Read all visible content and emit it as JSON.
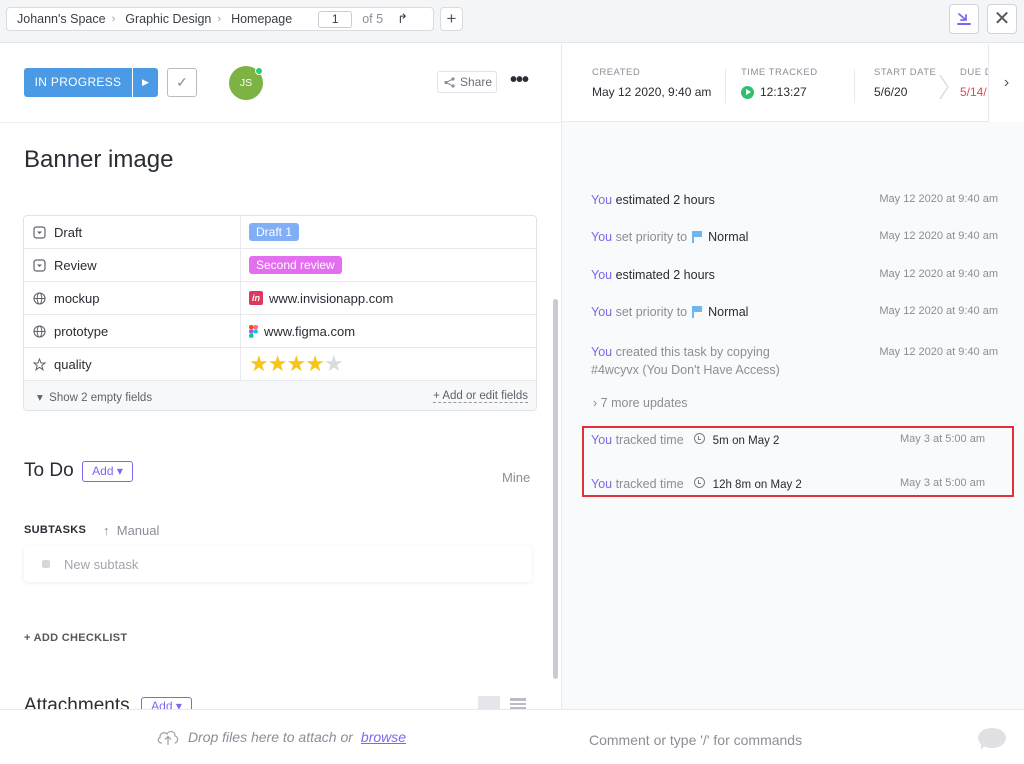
{
  "topbar": {
    "breadcrumbs": [
      "Johann's Space",
      "Graphic Design",
      "Homepage"
    ],
    "page_current": "1",
    "page_total": "of 5"
  },
  "task": {
    "status": "IN PROGRESS",
    "assignee_initials": "JS",
    "share_label": "Share",
    "title": "Banner image"
  },
  "fields": [
    {
      "name": "Draft",
      "icon": "dropdown-icon",
      "value": "Draft 1",
      "tag_color": "#80aef7"
    },
    {
      "name": "Review",
      "icon": "dropdown-icon",
      "value": "Second review",
      "tag_color": "#e36ff0"
    },
    {
      "name": "mockup",
      "icon": "globe-icon",
      "value": "www.invisionapp.com",
      "site_icon": "invision-icon"
    },
    {
      "name": "prototype",
      "icon": "globe-icon",
      "value": "www.figma.com",
      "site_icon": "figma-icon"
    },
    {
      "name": "quality",
      "icon": "star-outline-icon",
      "rating": 4,
      "rating_max": 5
    }
  ],
  "fields_footer": {
    "show_empty": "Show 2 empty fields",
    "add_edit": "+ Add or edit fields"
  },
  "todo": {
    "title": "To Do",
    "add_label": "Add",
    "mine_label": "Mine",
    "subtasks_label": "SUBTASKS",
    "sort_label": "Manual",
    "new_subtask_placeholder": "New subtask",
    "add_checklist": "+ ADD CHECKLIST"
  },
  "attachments": {
    "title": "Attachments",
    "add_label": "Add",
    "drop_text": "Drop files here to attach or",
    "browse_label": "browse"
  },
  "meta": {
    "created_label": "CREATED",
    "created_value": "May 12 2020, 9:40 am",
    "time_label": "TIME TRACKED",
    "time_value": "12:13:27",
    "start_label": "START DATE",
    "start_value": "5/6/20",
    "due_label": "DUE D",
    "due_value": "5/14/"
  },
  "activity": [
    {
      "who": "You",
      "text": "estimated 2 hours",
      "time": "May 12 2020 at 9:40 am"
    },
    {
      "who": "You",
      "text": "set priority to",
      "priority": "Normal",
      "time": "May 12 2020 at 9:40 am"
    },
    {
      "who": "You",
      "text": "estimated 2 hours",
      "time": "May 12 2020 at 9:40 am"
    },
    {
      "who": "You",
      "text": "set priority to",
      "priority": "Normal",
      "time": "May 12 2020 at 9:40 am"
    },
    {
      "who": "You",
      "text": "created this task by copying",
      "text2": "#4wcyvx (You Don't Have Access)",
      "time": "May 12 2020 at 9:40 am"
    }
  ],
  "more_updates": "7 more updates",
  "tracked": [
    {
      "who": "You",
      "text": "tracked time",
      "duration": "5m",
      "on": "on May 2",
      "time": "May 3 at 5:00 am"
    },
    {
      "who": "You",
      "text": "tracked time",
      "duration": "12h 8m",
      "on": "on May 2",
      "time": "May 3 at 5:00 am"
    }
  ],
  "comment": {
    "placeholder": "Comment or type '/' for commands"
  },
  "colors": {
    "accent": "#7b68ee",
    "status": "#4a9ae6",
    "highlight": "#e0303c",
    "due": "#e5484d"
  }
}
